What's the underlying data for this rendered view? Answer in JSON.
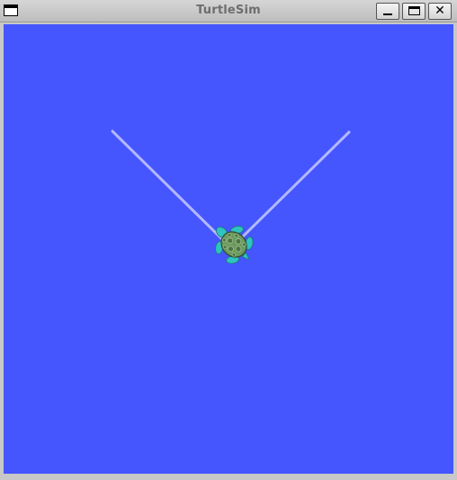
{
  "window": {
    "title": "TurtleSim",
    "buttons": {
      "minimize_icon": "minimize-icon",
      "maximize_icon": "maximize-icon",
      "close_icon": "close-icon",
      "close_glyph": "✕"
    }
  },
  "canvas": {
    "background_color": "#4556ff",
    "pen_color": "#b3b8ff"
  },
  "turtle": {
    "shell_color": "#6d9a5e",
    "limb_color": "#2fc4c0"
  }
}
